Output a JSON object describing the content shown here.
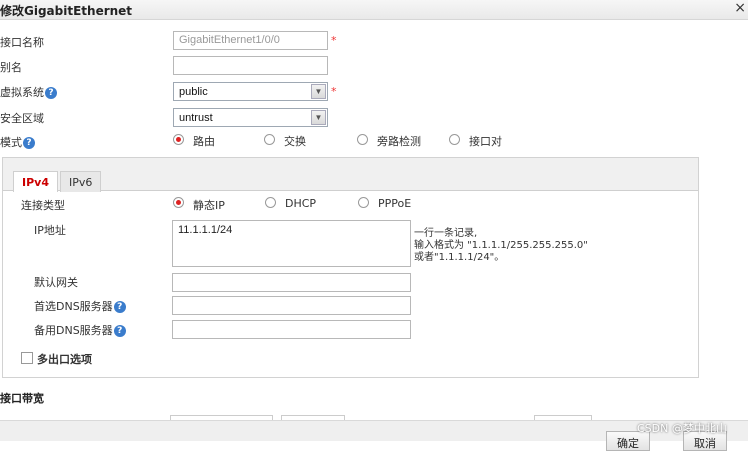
{
  "dialog": {
    "title": "修改GigabitEthernet",
    "close_symbol": "×"
  },
  "form": {
    "interface_name": {
      "label": "接口名称",
      "value": "GigabitEthernet1/0/0",
      "required_mark": "*"
    },
    "alias": {
      "label": "别名",
      "value": ""
    },
    "virtual_system": {
      "label": "虚拟系统",
      "value": "public",
      "required_mark": "*"
    },
    "security_zone": {
      "label": "安全区域",
      "value": "untrust"
    },
    "mode": {
      "label": "模式",
      "options": [
        "路由",
        "交换",
        "旁路检测",
        "接口对"
      ],
      "selected": "路由"
    }
  },
  "tabs": [
    {
      "label": "IPv4",
      "active": true
    },
    {
      "label": "IPv6",
      "active": false
    }
  ],
  "ipv4": {
    "connection_type": {
      "label": "连接类型",
      "options": [
        "静态IP",
        "DHCP",
        "PPPoE"
      ],
      "selected": "静态IP"
    },
    "ip_address": {
      "label": "IP地址",
      "value": "11.1.1.1/24",
      "hint_lines": [
        "一行一条记录,",
        "输入格式为 \"1.1.1.1/255.255.255.0\"",
        "或者\"1.1.1.1/24\"。"
      ]
    },
    "default_gateway": {
      "label": "默认网关",
      "value": ""
    },
    "primary_dns": {
      "label": "首选DNS服务器",
      "value": ""
    },
    "secondary_dns": {
      "label": "备用DNS服务器",
      "value": ""
    },
    "multi_egress": {
      "label": "多出口选项",
      "checked": false
    }
  },
  "bandwidth": {
    "title": "接口带宽"
  },
  "footer": {
    "ok_label": "确定",
    "cancel_label": "取消"
  },
  "watermark": "CSDN @梦中北山",
  "help_symbol": "?",
  "colors": {
    "accent_red": "#cc0000",
    "help_blue": "#3a7ccc"
  }
}
